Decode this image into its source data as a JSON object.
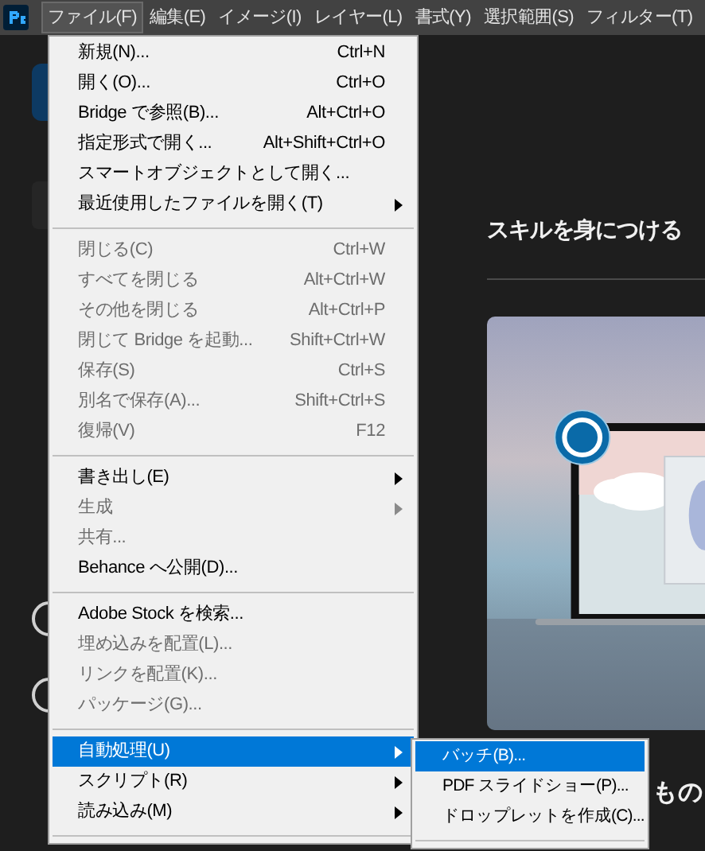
{
  "menubar": [
    {
      "label": "ファイル(F)",
      "selected": true
    },
    {
      "label": "編集(E)",
      "selected": false
    },
    {
      "label": "イメージ(I)",
      "selected": false
    },
    {
      "label": "レイヤー(L)",
      "selected": false
    },
    {
      "label": "書式(Y)",
      "selected": false
    },
    {
      "label": "選択範囲(S)",
      "selected": false
    },
    {
      "label": "フィルター(T)",
      "selected": false
    }
  ],
  "file_menu": [
    {
      "kind": "item",
      "label": "新規(N)...",
      "shortcut": "Ctrl+N",
      "disabled": false,
      "submenu": false,
      "selected": false
    },
    {
      "kind": "item",
      "label": "開く(O)...",
      "shortcut": "Ctrl+O",
      "disabled": false,
      "submenu": false,
      "selected": false
    },
    {
      "kind": "item",
      "label": "Bridge で参照(B)...",
      "shortcut": "Alt+Ctrl+O",
      "disabled": false,
      "submenu": false,
      "selected": false
    },
    {
      "kind": "item",
      "label": "指定形式で開く...",
      "shortcut": "Alt+Shift+Ctrl+O",
      "disabled": false,
      "submenu": false,
      "selected": false
    },
    {
      "kind": "item",
      "label": "スマートオブジェクトとして開く...",
      "disabled": false,
      "submenu": false,
      "selected": false
    },
    {
      "kind": "item",
      "label": "最近使用したファイルを開く(T)",
      "disabled": false,
      "submenu": true,
      "selected": false
    },
    {
      "kind": "separator"
    },
    {
      "kind": "item",
      "label": "閉じる(C)",
      "shortcut": "Ctrl+W",
      "disabled": true,
      "submenu": false,
      "selected": false
    },
    {
      "kind": "item",
      "label": "すべてを閉じる",
      "shortcut": "Alt+Ctrl+W",
      "disabled": true,
      "submenu": false,
      "selected": false
    },
    {
      "kind": "item",
      "label": "その他を閉じる",
      "shortcut": "Alt+Ctrl+P",
      "disabled": true,
      "submenu": false,
      "selected": false
    },
    {
      "kind": "item",
      "label": "閉じて Bridge を起動...",
      "shortcut": "Shift+Ctrl+W",
      "disabled": true,
      "submenu": false,
      "selected": false
    },
    {
      "kind": "item",
      "label": "保存(S)",
      "shortcut": "Ctrl+S",
      "disabled": true,
      "submenu": false,
      "selected": false
    },
    {
      "kind": "item",
      "label": "別名で保存(A)...",
      "shortcut": "Shift+Ctrl+S",
      "disabled": true,
      "submenu": false,
      "selected": false
    },
    {
      "kind": "item",
      "label": "復帰(V)",
      "shortcut": "F12",
      "disabled": true,
      "submenu": false,
      "selected": false
    },
    {
      "kind": "separator"
    },
    {
      "kind": "item",
      "label": "書き出し(E)",
      "disabled": false,
      "submenu": true,
      "selected": false
    },
    {
      "kind": "item",
      "label": "生成",
      "disabled": true,
      "submenu": true,
      "selected": false
    },
    {
      "kind": "item",
      "label": "共有...",
      "disabled": true,
      "submenu": false,
      "selected": false
    },
    {
      "kind": "item",
      "label": "Behance へ公開(D)...",
      "disabled": false,
      "submenu": false,
      "selected": false
    },
    {
      "kind": "separator"
    },
    {
      "kind": "item",
      "label": "Adobe Stock を検索...",
      "disabled": false,
      "submenu": false,
      "selected": false
    },
    {
      "kind": "item",
      "label": "埋め込みを配置(L)...",
      "disabled": true,
      "submenu": false,
      "selected": false
    },
    {
      "kind": "item",
      "label": "リンクを配置(K)...",
      "disabled": true,
      "submenu": false,
      "selected": false
    },
    {
      "kind": "item",
      "label": "パッケージ(G)...",
      "disabled": true,
      "submenu": false,
      "selected": false
    },
    {
      "kind": "separator"
    },
    {
      "kind": "item",
      "label": "自動処理(U)",
      "disabled": false,
      "submenu": true,
      "selected": true
    },
    {
      "kind": "item",
      "label": "スクリプト(R)",
      "disabled": false,
      "submenu": true,
      "selected": false
    },
    {
      "kind": "item",
      "label": "読み込み(M)",
      "disabled": false,
      "submenu": true,
      "selected": false
    },
    {
      "kind": "separator"
    }
  ],
  "submenu": [
    {
      "kind": "item",
      "label": "バッチ(B)...",
      "disabled": false,
      "selected": true
    },
    {
      "kind": "item",
      "label": "PDF スライドショー(P)...",
      "disabled": false,
      "selected": false
    },
    {
      "kind": "item",
      "label": "ドロップレットを作成(C)...",
      "disabled": false,
      "selected": false
    },
    {
      "kind": "separator"
    }
  ],
  "home": {
    "heading": "スキルを身につける",
    "card_text": "もの"
  }
}
